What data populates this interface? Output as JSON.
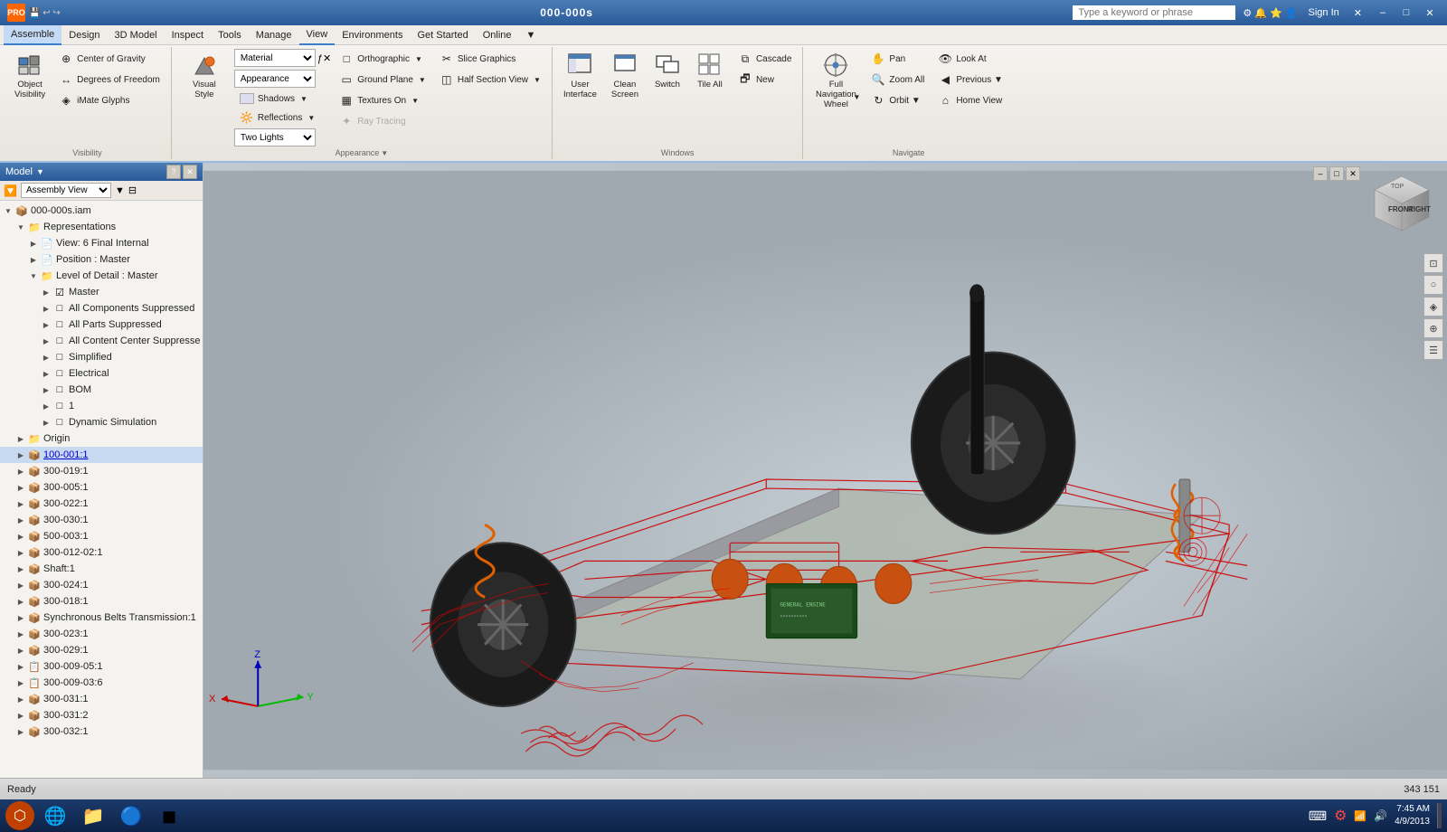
{
  "titlebar": {
    "app_icon": "PRO",
    "title": "000-000s",
    "search_placeholder": "Type a keyword or phrase",
    "signin": "Sign In",
    "min_btn": "–",
    "max_btn": "□",
    "close_btn": "✕"
  },
  "menubar": {
    "items": [
      {
        "id": "assemble",
        "label": "Assemble"
      },
      {
        "id": "design",
        "label": "Design"
      },
      {
        "id": "3dmodel",
        "label": "3D Model"
      },
      {
        "id": "inspect",
        "label": "Inspect"
      },
      {
        "id": "tools",
        "label": "Tools"
      },
      {
        "id": "manage",
        "label": "Manage"
      },
      {
        "id": "view",
        "label": "View",
        "active": true
      },
      {
        "id": "environments",
        "label": "Environments"
      },
      {
        "id": "getstarted",
        "label": "Get Started"
      },
      {
        "id": "online",
        "label": "Online"
      },
      {
        "id": "extra",
        "label": "▼"
      }
    ]
  },
  "ribbon": {
    "active_tab": "View",
    "groups": [
      {
        "id": "visibility",
        "label": "Visibility",
        "items": [
          {
            "id": "object-visibility",
            "icon": "👁",
            "label": "Object\nVisibility",
            "type": "large"
          },
          {
            "id": "center-gravity",
            "icon": "⊕",
            "label": "Center of Gravity",
            "type": "small"
          },
          {
            "id": "degrees-freedom",
            "icon": "↔",
            "label": "Degrees of Freedom",
            "type": "small"
          },
          {
            "id": "imate-glyphs",
            "icon": "◈",
            "label": "iMate Glyphs",
            "type": "small"
          }
        ]
      },
      {
        "id": "appearance",
        "label": "Appearance ▼",
        "items": [
          {
            "id": "visual-style",
            "icon": "🎨",
            "label": "Visual Style",
            "type": "large"
          },
          {
            "id": "material",
            "label": "Material",
            "type": "dropdown",
            "value": "Material"
          },
          {
            "id": "appearance-dd",
            "label": "Appearance",
            "type": "dropdown",
            "value": "Appearance"
          },
          {
            "id": "shadows",
            "label": "Shadows ▼",
            "type": "small-dd",
            "icon": "☁"
          },
          {
            "id": "reflections",
            "label": "Reflections ▼",
            "type": "small-dd",
            "icon": "🔆"
          },
          {
            "id": "two-lights",
            "label": "Two Lights",
            "type": "select"
          },
          {
            "id": "orthographic",
            "label": "Orthographic ▼",
            "type": "small-dd",
            "icon": "□"
          },
          {
            "id": "ground-plane",
            "label": "Ground Plane ▼",
            "type": "small-dd",
            "icon": "▭"
          },
          {
            "id": "textures-on",
            "label": "Textures On ▼",
            "type": "small-dd",
            "icon": "▦"
          },
          {
            "id": "ray-tracing",
            "label": "Ray Tracing",
            "type": "small",
            "icon": "✦",
            "disabled": true
          },
          {
            "id": "slice-graphics",
            "label": "Slice Graphics",
            "type": "small",
            "icon": "✂"
          },
          {
            "id": "half-section",
            "label": "Half Section View ▼",
            "type": "small-dd",
            "icon": "◫"
          }
        ]
      },
      {
        "id": "windows",
        "label": "Windows",
        "items": [
          {
            "id": "user-interface",
            "icon": "🖥",
            "label": "User\nInterface",
            "type": "large"
          },
          {
            "id": "clean-screen",
            "icon": "⬜",
            "label": "Clean\nScreen",
            "type": "large"
          },
          {
            "id": "switch",
            "icon": "⇄",
            "label": "Switch",
            "type": "large"
          },
          {
            "id": "tile-all",
            "icon": "⊞",
            "label": "Tile All",
            "type": "large"
          },
          {
            "id": "cascade",
            "label": "Cascade",
            "type": "small",
            "icon": "⧉"
          },
          {
            "id": "new-window",
            "label": "New",
            "type": "small",
            "icon": "🗗"
          }
        ]
      },
      {
        "id": "navigate",
        "label": "Navigate",
        "items": [
          {
            "id": "full-nav-wheel",
            "icon": "⊙",
            "label": "Full Navigation\nWheel",
            "type": "large-dd"
          },
          {
            "id": "pan",
            "label": "Pan",
            "type": "small",
            "icon": "✋"
          },
          {
            "id": "zoom-all",
            "label": "Zoom All",
            "type": "small",
            "icon": "🔍"
          },
          {
            "id": "orbit",
            "label": "Orbit ▼",
            "type": "small-dd",
            "icon": "↻"
          },
          {
            "id": "look-at",
            "label": "Look At",
            "type": "small",
            "icon": "👁"
          },
          {
            "id": "previous",
            "label": "Previous ▼",
            "type": "small-dd",
            "icon": "◀"
          },
          {
            "id": "home-view",
            "label": "Home View",
            "type": "small",
            "icon": "⌂"
          }
        ]
      }
    ]
  },
  "sidebar": {
    "title": "Model",
    "view_label": "Assembly View",
    "tree_items": [
      {
        "id": "root",
        "label": "000-000s.iam",
        "indent": 0,
        "expanded": true,
        "icon": "📦",
        "type": "assembly"
      },
      {
        "id": "representations",
        "label": "Representations",
        "indent": 1,
        "expanded": true,
        "icon": "📁"
      },
      {
        "id": "view6",
        "label": "View: 6 Final Internal",
        "indent": 2,
        "expanded": false,
        "icon": "📄"
      },
      {
        "id": "position",
        "label": "Position : Master",
        "indent": 2,
        "expanded": false,
        "icon": "📄"
      },
      {
        "id": "lod",
        "label": "Level of Detail : Master",
        "indent": 2,
        "expanded": true,
        "icon": "📁"
      },
      {
        "id": "master",
        "label": "Master",
        "indent": 3,
        "expanded": false,
        "icon": "☑",
        "checked": true
      },
      {
        "id": "all-comp-sup",
        "label": "All Components Suppressed",
        "indent": 3,
        "expanded": false,
        "icon": "□"
      },
      {
        "id": "all-parts-sup",
        "label": "All Parts Suppressed",
        "indent": 3,
        "expanded": false,
        "icon": "□"
      },
      {
        "id": "all-content-sup",
        "label": "All Content Center Suppresse",
        "indent": 3,
        "expanded": false,
        "icon": "□"
      },
      {
        "id": "simplified",
        "label": "Simplified",
        "indent": 3,
        "expanded": false,
        "icon": "□"
      },
      {
        "id": "electrical",
        "label": "Electrical",
        "indent": 3,
        "expanded": false,
        "icon": "□"
      },
      {
        "id": "bom",
        "label": "BOM",
        "indent": 3,
        "expanded": false,
        "icon": "□"
      },
      {
        "id": "item1",
        "label": "1",
        "indent": 3,
        "expanded": false,
        "icon": "□"
      },
      {
        "id": "dynamic-sim",
        "label": "Dynamic Simulation",
        "indent": 3,
        "expanded": false,
        "icon": "□"
      },
      {
        "id": "origin",
        "label": "Origin",
        "indent": 1,
        "expanded": false,
        "icon": "📁"
      },
      {
        "id": "100-001-1",
        "label": "100-001:1",
        "indent": 1,
        "expanded": false,
        "icon": "📦",
        "selected": true,
        "blue": true
      },
      {
        "id": "300-019-1",
        "label": "300-019:1",
        "indent": 1,
        "expanded": false,
        "icon": "📦"
      },
      {
        "id": "300-005-1",
        "label": "300-005:1",
        "indent": 1,
        "expanded": false,
        "icon": "📦"
      },
      {
        "id": "300-022-1",
        "label": "300-022:1",
        "indent": 1,
        "expanded": false,
        "icon": "📦"
      },
      {
        "id": "300-030-1",
        "label": "300-030:1",
        "indent": 1,
        "expanded": false,
        "icon": "📦"
      },
      {
        "id": "500-003-1",
        "label": "500-003:1",
        "indent": 1,
        "expanded": false,
        "icon": "📦"
      },
      {
        "id": "300-012-02-1",
        "label": "300-012-02:1",
        "indent": 1,
        "expanded": false,
        "icon": "📦"
      },
      {
        "id": "shaft-1",
        "label": "Shaft:1",
        "indent": 1,
        "expanded": false,
        "icon": "📦"
      },
      {
        "id": "300-024-1",
        "label": "300-024:1",
        "indent": 1,
        "expanded": false,
        "icon": "📦"
      },
      {
        "id": "300-018-1",
        "label": "300-018:1",
        "indent": 1,
        "expanded": false,
        "icon": "📦"
      },
      {
        "id": "sync-belts",
        "label": "Synchronous Belts Transmission:1",
        "indent": 1,
        "expanded": false,
        "icon": "📦"
      },
      {
        "id": "300-023-1",
        "label": "300-023:1",
        "indent": 1,
        "expanded": false,
        "icon": "📦"
      },
      {
        "id": "300-029-1",
        "label": "300-029:1",
        "indent": 1,
        "expanded": false,
        "icon": "📦"
      },
      {
        "id": "300-009-05-1",
        "label": "300-009-05:1",
        "indent": 1,
        "expanded": false,
        "icon": "📋"
      },
      {
        "id": "300-009-03-6",
        "label": "300-009-03:6",
        "indent": 1,
        "expanded": false,
        "icon": "📋"
      },
      {
        "id": "300-031-1",
        "label": "300-031:1",
        "indent": 1,
        "expanded": false,
        "icon": "📦"
      },
      {
        "id": "300-031-2",
        "label": "300-031:2",
        "indent": 1,
        "expanded": false,
        "icon": "📦"
      },
      {
        "id": "300-032-1",
        "label": "300-032:1",
        "indent": 1,
        "expanded": false,
        "icon": "📦"
      }
    ]
  },
  "statusbar": {
    "status": "Ready",
    "coords": "343   151"
  },
  "taskbar": {
    "apps": [
      {
        "id": "inventor",
        "icon": "🔶",
        "label": "Inventor"
      },
      {
        "id": "ie",
        "icon": "🌐",
        "label": "Internet Explorer"
      },
      {
        "id": "files",
        "icon": "📁",
        "label": "Files"
      },
      {
        "id": "chrome",
        "icon": "🔵",
        "label": "Chrome"
      },
      {
        "id": "app5",
        "icon": "◼",
        "label": "App"
      }
    ],
    "clock": {
      "time": "7:45 AM",
      "date": "4/9/2013"
    }
  }
}
